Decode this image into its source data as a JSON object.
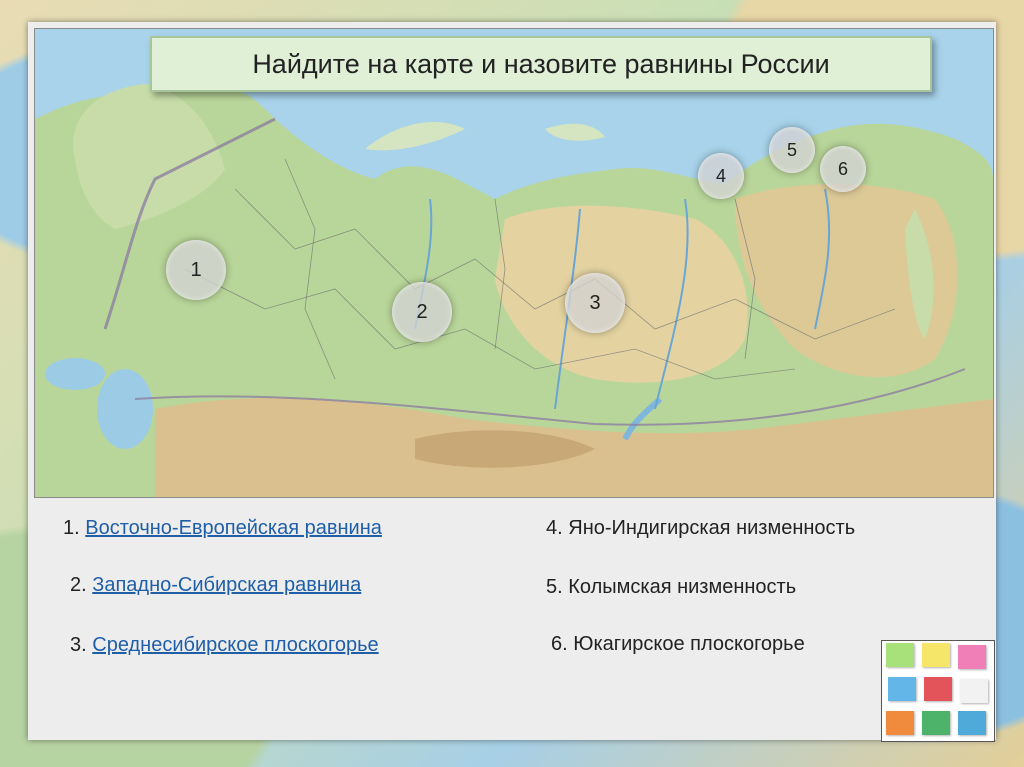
{
  "title": "Найдите на карте и назовите равнины России",
  "markers": [
    {
      "label": "1"
    },
    {
      "label": "2"
    },
    {
      "label": "3"
    },
    {
      "label": "4"
    },
    {
      "label": "5"
    },
    {
      "label": "6"
    }
  ],
  "items": [
    {
      "number": "1.",
      "text": "Восточно-Европейская равнина",
      "link": true
    },
    {
      "number": "2.",
      "text": "Западно-Сибирская  равнина",
      "link": true
    },
    {
      "number": "3.",
      "text": "Среднесибирское плоскогорье",
      "link": true
    },
    {
      "number": "4.",
      "text": "Яно-Индигирская низменность",
      "link": false
    },
    {
      "number": "5.",
      "text": "Колымская низменность",
      "link": false
    },
    {
      "number": "6.",
      "text": "Юкагирское плоскогорье",
      "link": false
    }
  ],
  "colors": {
    "sea": "#a8d3ea",
    "lowland": "#b9d69a",
    "highland": "#e4d3a1",
    "mountain": "#c9a877",
    "link": "#1f5fa8",
    "title_bg": "#dff0d6"
  }
}
